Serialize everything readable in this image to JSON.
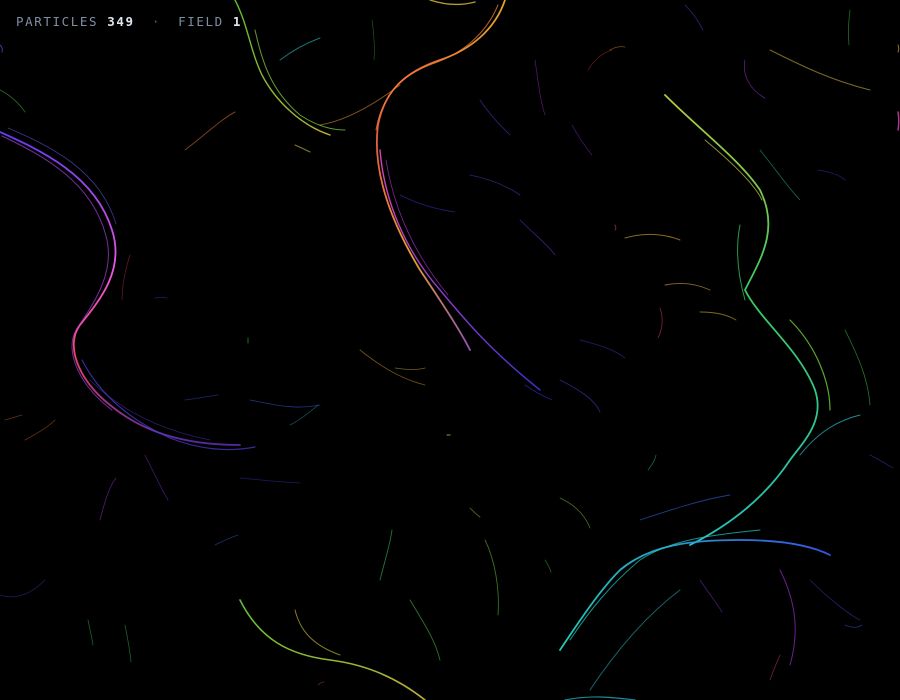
{
  "hud": {
    "particles_label": "PARTICLES",
    "particles_value": "349",
    "separator": "·",
    "field_label": "FIELD",
    "field_value": "1"
  },
  "palette": {
    "background": "#000000",
    "hud_label": "#7f8fa3",
    "hud_value": "#dfe6ee",
    "stroke_hues": [
      "magenta",
      "violet",
      "blue",
      "cyan",
      "green",
      "yellow",
      "orange",
      "red"
    ]
  }
}
